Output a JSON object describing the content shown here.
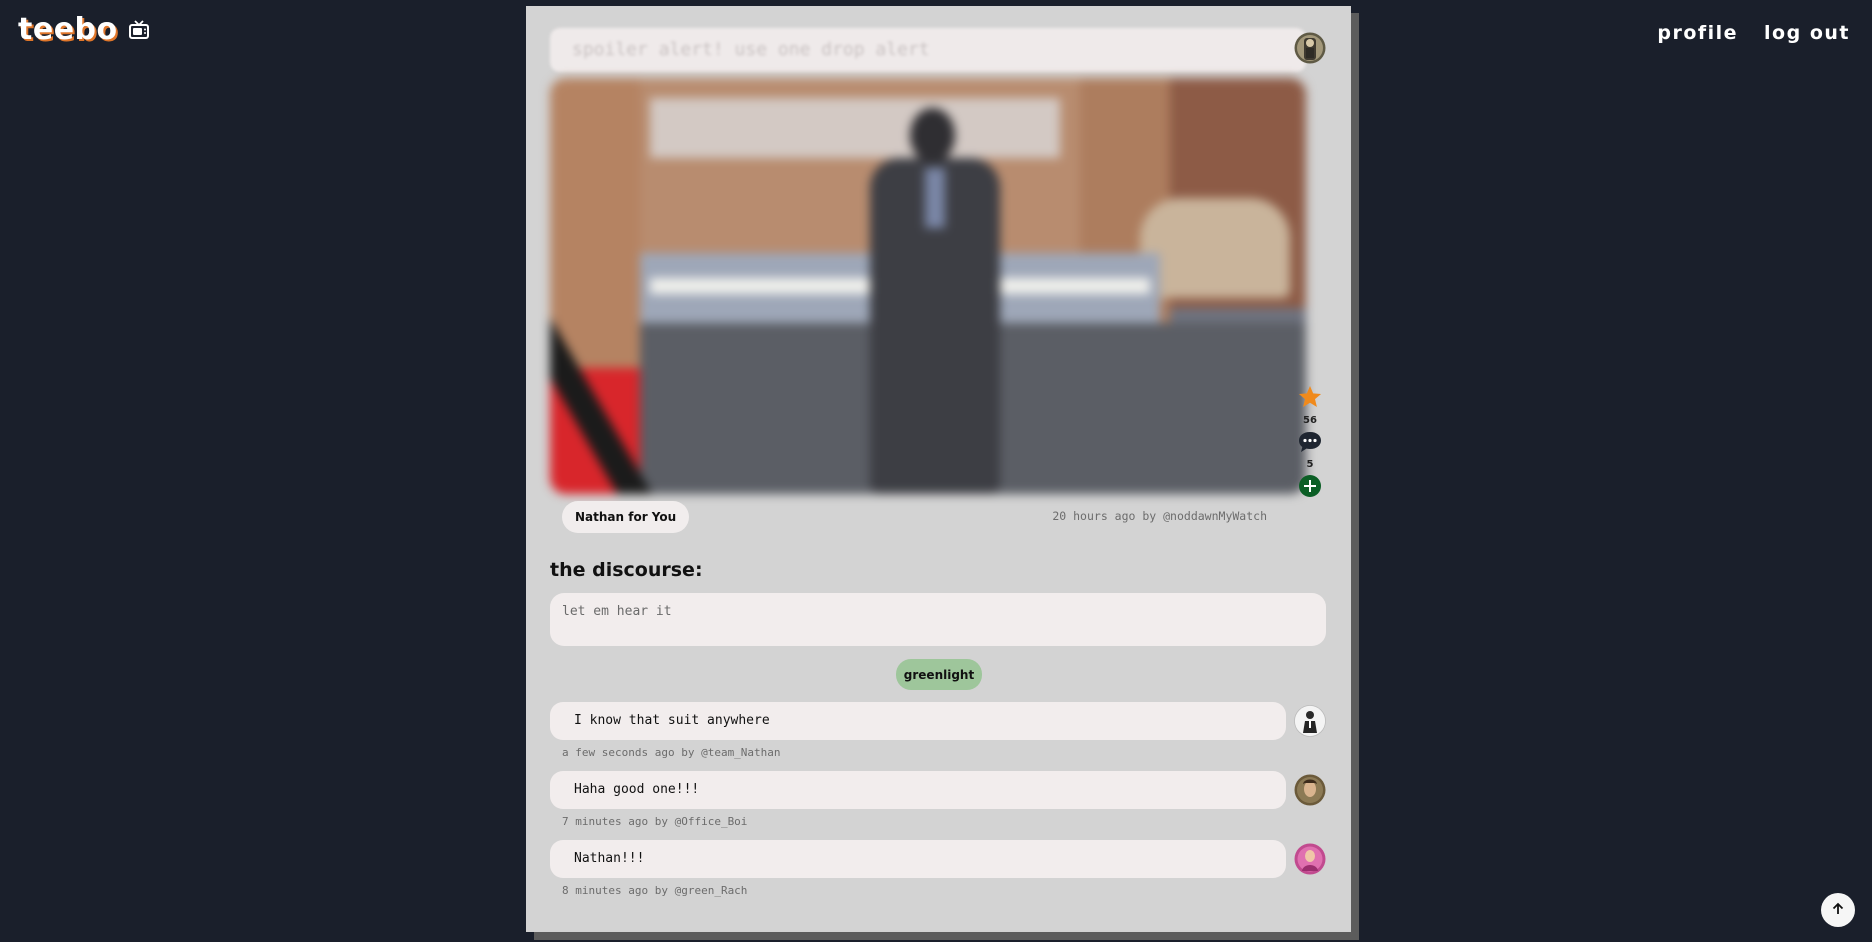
{
  "app": {
    "logo_text": "teebo",
    "logo_icon": "tv-icon",
    "brand_accent": "#e0762a",
    "background": "#1a1f2b"
  },
  "nav": {
    "profile_label": "profile",
    "logout_label": "log out"
  },
  "post": {
    "title": "spoiler alert! use one drop alert",
    "show_name": "Nathan for You",
    "meta": "20 hours ago by @noddawnMyWatch",
    "star_count": "56",
    "comment_count": "5",
    "star_icon": "star-icon",
    "comment_icon": "comment-bubble-icon",
    "add_icon": "plus-circle-icon"
  },
  "discourse": {
    "title": "the discourse:",
    "input_placeholder": "let em hear it",
    "submit_label": "greenlight",
    "submit_color": "#9ec69b"
  },
  "comments": [
    {
      "text": "I know that suit anywhere",
      "meta": "a few seconds ago by @team_Nathan"
    },
    {
      "text": "Haha good one!!!",
      "meta": "7 minutes ago by @Office_Boi"
    },
    {
      "text": "Nathan!!!",
      "meta": "8 minutes ago by @green_Rach"
    }
  ],
  "scroll_top_icon": "arrow-up-icon"
}
